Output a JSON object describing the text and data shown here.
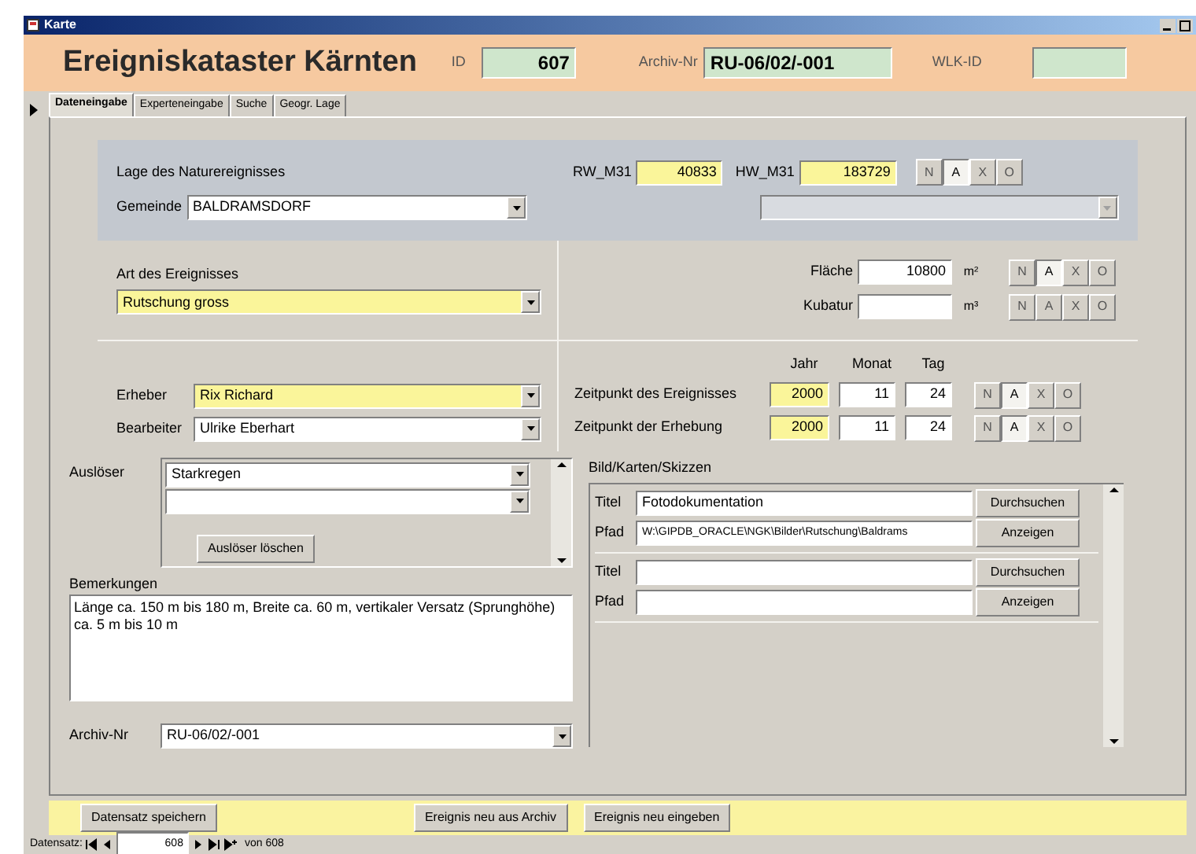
{
  "window": {
    "title": "Karte"
  },
  "header": {
    "title": "Ereigniskataster Kärnten",
    "id_label": "ID",
    "id_value": "607",
    "archive_label": "Archiv-Nr",
    "archive_value": "RU-06/02/-001",
    "wlk_label": "WLK-ID"
  },
  "tabs": [
    {
      "label": "Dateneingabe",
      "selected": true
    },
    {
      "label": "Experteneingabe",
      "selected": false
    },
    {
      "label": "Suche",
      "selected": false
    },
    {
      "label": "Geogr. Lage",
      "selected": false
    }
  ],
  "location": {
    "heading": "Lage des Naturereignisses",
    "municipality_label": "Gemeinde",
    "municipality": "BALDRAMSDORF",
    "rw_label": "RW_M31",
    "rw": "40833",
    "hw_label": "HW_M31",
    "hw": "183729",
    "naxo": [
      {
        "label": "N",
        "selected": false
      },
      {
        "label": "A",
        "selected": true
      },
      {
        "label": "X",
        "selected": false
      },
      {
        "label": "O",
        "selected": false
      }
    ]
  },
  "event_type": {
    "label": "Art des Ereignisses",
    "value": "Rutschung gross"
  },
  "measures": [
    {
      "label": "Fläche",
      "value": "10800",
      "unit": "m²",
      "naxo": [
        {
          "label": "N",
          "selected": false
        },
        {
          "label": "A",
          "selected": true
        },
        {
          "label": "X",
          "selected": false
        },
        {
          "label": "O",
          "selected": false
        }
      ]
    },
    {
      "label": "Kubatur",
      "unit": "m³",
      "naxo": [
        {
          "label": "N",
          "selected": false
        },
        {
          "label": "A",
          "selected": false
        },
        {
          "label": "X",
          "selected": false
        },
        {
          "label": "O",
          "selected": false
        }
      ]
    }
  ],
  "people": [
    {
      "label": "Erheber",
      "value": "Rix Richard",
      "required": true
    },
    {
      "label": "Bearbeiter",
      "value": "Ulrike Eberhart",
      "required": false
    }
  ],
  "dates": {
    "columns": [
      "Jahr",
      "Monat",
      "Tag"
    ],
    "rows": [
      {
        "label": "Zeitpunkt des Ereignisses",
        "year": "2000",
        "month": "11",
        "day": "24",
        "naxo": [
          {
            "label": "N",
            "selected": false
          },
          {
            "label": "A",
            "selected": true
          },
          {
            "label": "X",
            "selected": false
          },
          {
            "label": "O",
            "selected": false
          }
        ]
      },
      {
        "label": "Zeitpunkt der Erhebung",
        "year": "2000",
        "month": "11",
        "day": "24",
        "naxo": [
          {
            "label": "N",
            "selected": false
          },
          {
            "label": "A",
            "selected": true
          },
          {
            "label": "X",
            "selected": false
          },
          {
            "label": "O",
            "selected": false
          }
        ]
      }
    ]
  },
  "triggers": {
    "label": "Auslöser",
    "values": [
      "Starkregen"
    ],
    "new_row": true,
    "delete_button": "Auslöser löschen"
  },
  "remarks": {
    "label": "Bemerkungen",
    "value": "Länge ca. 150 m bis 180 m, Breite ca. 60 m, vertikaler Versatz (Sprunghöhe) ca. 5 m bis 10 m"
  },
  "archive": {
    "label": "Archiv-Nr",
    "value": "RU-06/02/-001"
  },
  "pictures": {
    "label": "Bild/Karten/Skizzen",
    "rows": [
      {
        "title_label": "Titel",
        "title": "Fotodokumentation",
        "path_label": "Pfad",
        "path": "W:\\GIPDB_ORACLE\\NGK\\Bilder\\Rutschung\\Baldrams",
        "browse": "Durchsuchen",
        "show": "Anzeigen"
      }
    ],
    "new_row": {
      "title_label": "Titel",
      "path_label": "Pfad",
      "browse": "Durchsuchen",
      "show": "Anzeigen"
    }
  },
  "footer_buttons": [
    "Datensatz speichern",
    "Ereignis neu aus Archiv",
    "Ereignis neu eingeben"
  ],
  "navigation": {
    "label": "Datensatz:",
    "record": "608",
    "total": "von 608"
  }
}
